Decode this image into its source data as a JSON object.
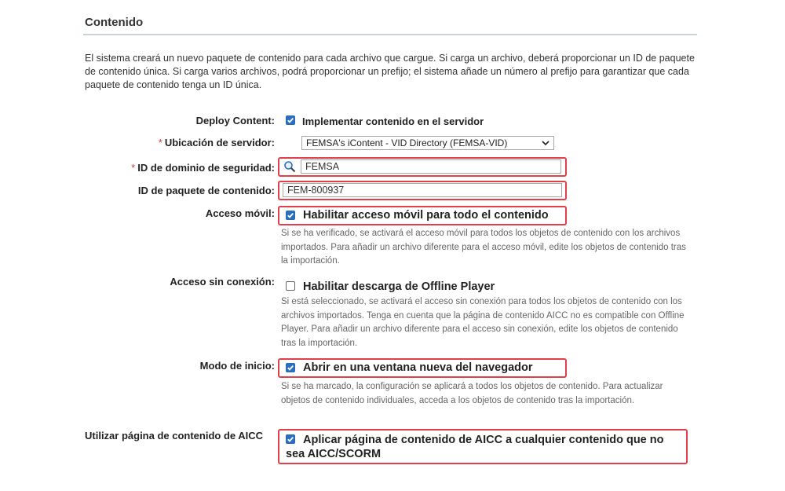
{
  "section": {
    "title": "Contenido",
    "intro": "El sistema creará un nuevo paquete de contenido para cada archivo que cargue. Si carga un archivo, deberá proporcionar un ID de paquete de contenido única. Si carga varios archivos, podrá proporcionar un prefijo; el sistema añade un número al prefijo para garantizar que cada paquete de contenido tenga un ID única."
  },
  "form": {
    "deploy": {
      "label": "Deploy Content:",
      "option": "Implementar contenido en el servidor",
      "checked": true
    },
    "server": {
      "required_mark": "*",
      "label": "Ubicación de servidor:",
      "selected": "FEMSA's iContent - VID Directory (FEMSA-VID)"
    },
    "security_domain": {
      "required_mark": "*",
      "label": "ID de dominio de seguridad:",
      "value": "FEMSA"
    },
    "package_id": {
      "label": "ID de paquete de contenido:",
      "value": "FEM-800937"
    },
    "mobile": {
      "label": "Acceso móvil:",
      "option": "Habilitar acceso móvil para todo el contenido",
      "checked": true,
      "help": "Si se ha verificado, se activará el acceso móvil para todos los objetos de contenido con los archivos importados. Para añadir un archivo diferente para el acceso móvil, edite los objetos de contenido tras la importación."
    },
    "offline": {
      "label": "Acceso sin conexión:",
      "option": "Habilitar descarga de Offline Player",
      "checked": false,
      "help": "Si está seleccionado, se activará el acceso sin conexión para todos los objetos de contenido con los archivos importados. Tenga en cuenta que la página de contenido AICC no es compatible con Offline Player. Para añadir un archivo diferente para el acceso sin conexión, edite los objetos de contenido tras la importación."
    },
    "launch": {
      "label": "Modo de inicio:",
      "option": "Abrir en una ventana nueva del navegador",
      "checked": true,
      "help": "Si se ha marcado, la configuración se aplicará a todos los objetos de contenido. Para actualizar objetos de contenido individuales, acceda a los objetos de contenido tras la importación."
    },
    "aicc": {
      "label": "Utilizar página de contenido de AICC",
      "option": "Aplicar página de contenido de AICC a cualquier contenido que no sea AICC/SCORM",
      "checked": true
    }
  },
  "icons": {
    "lookup": "magnifier-lookup-icon",
    "checkmark": "checkmark-icon",
    "dropdown": "chevron-down-icon"
  },
  "colors": {
    "highlight": "#e0404c",
    "checkbox": "#2a6fc4",
    "required": "#d23c3c"
  }
}
